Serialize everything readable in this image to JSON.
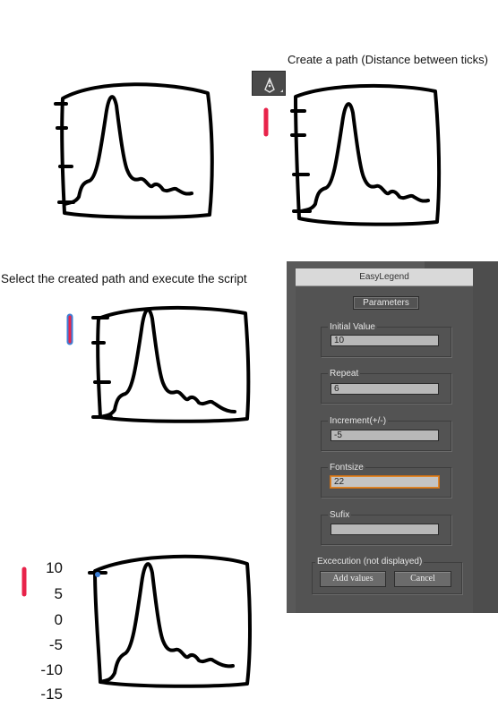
{
  "captions": {
    "step1": "Create a path (Distance between ticks)",
    "step2": "Select  the created path  and execute the script"
  },
  "tool": {
    "icon": "pen-tool-icon"
  },
  "dialog": {
    "title": "EasyLegend",
    "panel_label": "Parameters",
    "fields": [
      {
        "label": "Initial Value",
        "value": "10"
      },
      {
        "label": "Repeat",
        "value": "6"
      },
      {
        "label": "Increment(+/-)",
        "value": "-5"
      },
      {
        "label": "Fontsize",
        "value": "22"
      },
      {
        "label": "Sufix",
        "value": ""
      }
    ],
    "exec_label": "Excecution (not displayed)",
    "add_button": "Add values",
    "cancel_button": "Cancel"
  },
  "result_labels": [
    "10",
    "5",
    "0",
    "-5",
    "-10",
    "-15"
  ],
  "colors": {
    "path_highlight": "#e8234a",
    "selection_blue": "#3d7fd6",
    "dialog_bg": "#535353",
    "focus_border": "#e0862a"
  }
}
